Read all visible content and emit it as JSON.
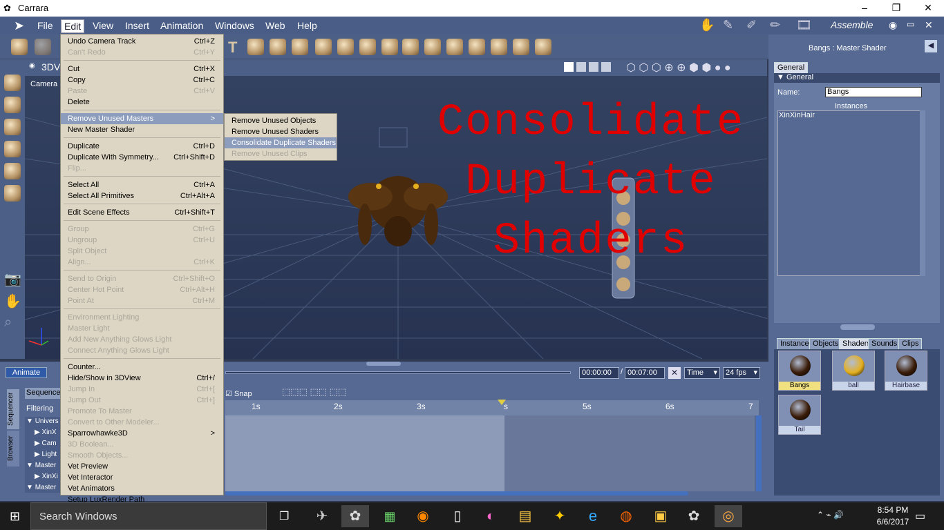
{
  "window": {
    "title": "Carrara",
    "minimize": "–",
    "restore": "❐",
    "close": "✕"
  },
  "menubar": {
    "items": [
      "File",
      "Edit",
      "View",
      "Insert",
      "Animation",
      "Windows",
      "Web",
      "Help"
    ],
    "active": "Edit",
    "room": "Assemble"
  },
  "view": {
    "tab": "3DV",
    "camera": "Camera 1"
  },
  "overlay": {
    "line1": "Consolidate",
    "line2": "Duplicate",
    "line3": "Shaders"
  },
  "edit_menu": {
    "items": [
      {
        "label": "Undo Camera Track",
        "shortcut": "Ctrl+Z",
        "disabled": false
      },
      {
        "label": "Can't Redo",
        "shortcut": "Ctrl+Y",
        "disabled": true
      },
      {
        "label": "Cut",
        "shortcut": "Ctrl+X",
        "disabled": false
      },
      {
        "label": "Copy",
        "shortcut": "Ctrl+C",
        "disabled": false
      },
      {
        "label": "Paste",
        "shortcut": "Ctrl+V",
        "disabled": true
      },
      {
        "label": "Delete",
        "shortcut": "",
        "disabled": false
      },
      {
        "label": "Remove Unused Masters",
        "shortcut": ">",
        "disabled": false
      },
      {
        "label": "New Master Shader",
        "shortcut": "",
        "disabled": false
      },
      {
        "label": "Duplicate",
        "shortcut": "Ctrl+D",
        "disabled": false
      },
      {
        "label": "Duplicate With Symmetry...",
        "shortcut": "Ctrl+Shift+D",
        "disabled": false
      },
      {
        "label": "Flip...",
        "shortcut": "",
        "disabled": true
      },
      {
        "label": "Select All",
        "shortcut": "Ctrl+A",
        "disabled": false
      },
      {
        "label": "Select All Primitives",
        "shortcut": "Ctrl+Alt+A",
        "disabled": false
      },
      {
        "label": "Edit Scene Effects",
        "shortcut": "Ctrl+Shift+T",
        "disabled": false
      },
      {
        "label": "Group",
        "shortcut": "Ctrl+G",
        "disabled": true
      },
      {
        "label": "Ungroup",
        "shortcut": "Ctrl+U",
        "disabled": true
      },
      {
        "label": "Split Object",
        "shortcut": "",
        "disabled": true
      },
      {
        "label": "Align...",
        "shortcut": "Ctrl+K",
        "disabled": true
      },
      {
        "label": "Send to Origin",
        "shortcut": "Ctrl+Shift+O",
        "disabled": true
      },
      {
        "label": "Center Hot Point",
        "shortcut": "Ctrl+Alt+H",
        "disabled": true
      },
      {
        "label": "Point At",
        "shortcut": "Ctrl+M",
        "disabled": true
      },
      {
        "label": "Environment Lighting",
        "shortcut": "",
        "disabled": true
      },
      {
        "label": "Master Light",
        "shortcut": "",
        "disabled": true
      },
      {
        "label": "Add New Anything Glows Light",
        "shortcut": "",
        "disabled": true
      },
      {
        "label": "Connect Anything Glows Light",
        "shortcut": "",
        "disabled": true
      },
      {
        "label": "Counter...",
        "shortcut": "",
        "disabled": false
      },
      {
        "label": "Hide/Show in 3DView",
        "shortcut": "Ctrl+/",
        "disabled": false
      },
      {
        "label": "Jump In",
        "shortcut": "Ctrl+[",
        "disabled": true
      },
      {
        "label": "Jump Out",
        "shortcut": "Ctrl+]",
        "disabled": true
      },
      {
        "label": "Promote To Master",
        "shortcut": "",
        "disabled": true
      },
      {
        "label": "Convert to Other Modeler...",
        "shortcut": "",
        "disabled": true
      },
      {
        "label": "Sparrowhawke3D",
        "shortcut": ">",
        "disabled": false
      },
      {
        "label": "3D Boolean...",
        "shortcut": "",
        "disabled": true
      },
      {
        "label": "Smooth Objects...",
        "shortcut": "",
        "disabled": true
      },
      {
        "label": "Vet Preview",
        "shortcut": "",
        "disabled": false
      },
      {
        "label": "Vet Interactor",
        "shortcut": "",
        "disabled": false
      },
      {
        "label": "Vet Animators",
        "shortcut": "",
        "disabled": false
      },
      {
        "label": "Setup LuxRender Path",
        "shortcut": "",
        "disabled": false
      }
    ]
  },
  "submenu": {
    "items": [
      {
        "label": "Remove Unused Objects",
        "disabled": false
      },
      {
        "label": "Remove Unused Shaders",
        "disabled": false
      },
      {
        "label": "Consolidate Duplicate Shaders",
        "disabled": false
      },
      {
        "label": "Remove Unused Clips",
        "disabled": true
      }
    ]
  },
  "properties": {
    "title": "Bangs : Master Shader",
    "tab": "General",
    "section": "General",
    "name_label": "Name:",
    "name_value": "Bangs",
    "instances_label": "Instances",
    "instances": [
      "XinXinHair"
    ]
  },
  "browser": {
    "tabs": [
      "Instance",
      "Objects",
      "Shaders",
      "Sounds",
      "Clips"
    ],
    "active_tab": "Shaders",
    "shaders": [
      {
        "name": "Bangs",
        "color": "#3a1c08",
        "selected": true
      },
      {
        "name": "ball",
        "color": "#e5b020",
        "selected": false
      },
      {
        "name": "Hairbase",
        "color": "#3a1c08",
        "selected": false
      },
      {
        "name": "Tail",
        "color": "#3a1c08",
        "selected": false
      }
    ]
  },
  "timeline": {
    "animate_label": "Animate",
    "current_time": "00:00:00",
    "slash": "/",
    "end_time": "00:07:00",
    "time_mode": "Time",
    "fps": "24 fps",
    "snap": "Snap",
    "ticks": [
      "1s",
      "2s",
      "3s",
      "s",
      "5s",
      "6s",
      "7"
    ],
    "side_tabs": [
      "Sequencer",
      "Browser"
    ],
    "sequencer_btn": "Sequencer",
    "filtering": "Filtering",
    "tracks": [
      "Univers",
      "XinX",
      "Cam",
      "Light",
      "Master",
      "XinXi",
      "Master"
    ]
  },
  "taskbar": {
    "search": "Search Windows",
    "time": "8:54 PM",
    "date": "6/6/2017"
  }
}
